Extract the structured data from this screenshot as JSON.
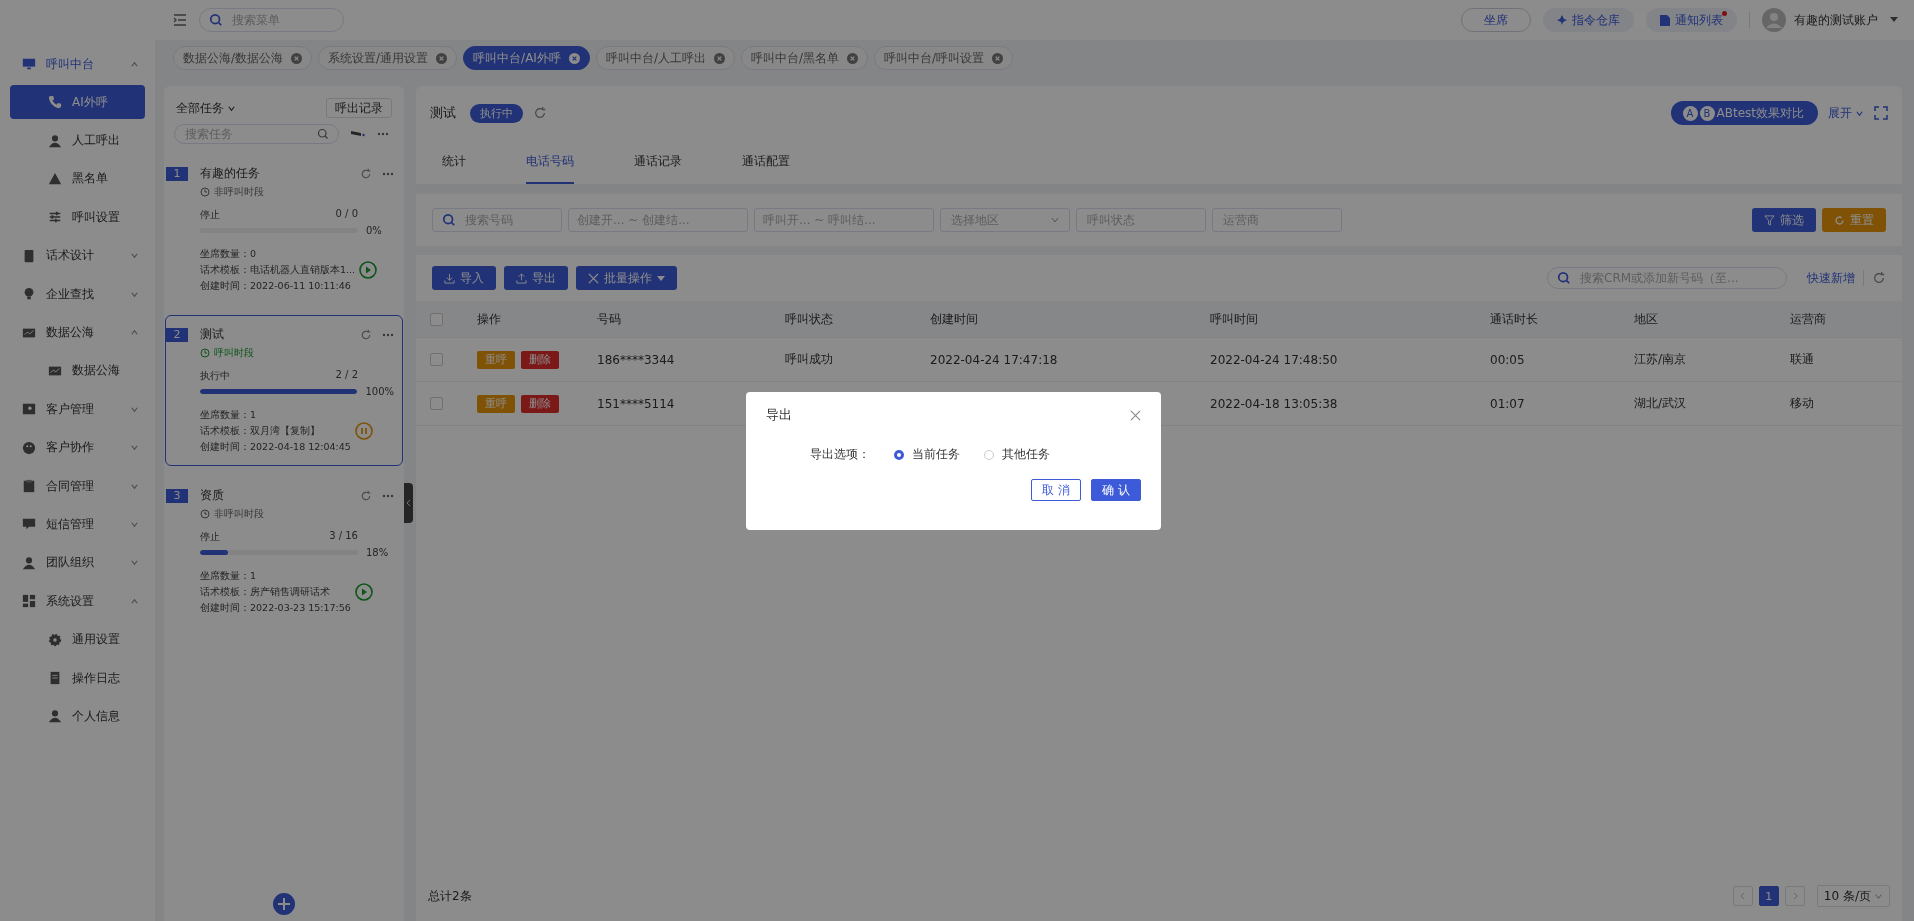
{
  "topbar": {
    "search_placeholder": "搜索菜单",
    "buttons": [
      {
        "label": "坐席",
        "unread": false
      },
      {
        "label": "指令仓库",
        "unread": false
      },
      {
        "label": "通知列表",
        "unread": true
      }
    ],
    "user": "有趣的测试账户"
  },
  "sidebar": {
    "items": [
      {
        "label": "呼叫中台",
        "expanded": true,
        "children": [
          {
            "label": "AI外呼",
            "selected": true
          },
          {
            "label": "人工呼出",
            "selected": false
          },
          {
            "label": "黑名单",
            "selected": false
          },
          {
            "label": "呼叫设置",
            "selected": false
          }
        ]
      },
      {
        "label": "话术设计",
        "expanded": false
      },
      {
        "label": "企业查找",
        "expanded": false
      },
      {
        "label": "数据公海",
        "expanded": true,
        "children": [
          {
            "label": "数据公海",
            "selected": false
          }
        ]
      },
      {
        "label": "客户管理",
        "expanded": false
      },
      {
        "label": "客户协作",
        "expanded": false
      },
      {
        "label": "合同管理",
        "expanded": false
      },
      {
        "label": "短信管理",
        "expanded": false
      },
      {
        "label": "团队组织",
        "expanded": false
      },
      {
        "label": "系统设置",
        "expanded": true,
        "children": [
          {
            "label": "通用设置",
            "selected": false
          },
          {
            "label": "操作日志",
            "selected": false
          },
          {
            "label": "个人信息",
            "selected": false
          }
        ]
      }
    ]
  },
  "tabs": [
    {
      "label": "数据公海/数据公海",
      "selected": false
    },
    {
      "label": "系统设置/通用设置",
      "selected": false
    },
    {
      "label": "呼叫中台/AI外呼",
      "selected": true
    },
    {
      "label": "呼叫中台/人工呼出",
      "selected": false
    },
    {
      "label": "呼叫中台/黑名单",
      "selected": false
    },
    {
      "label": "呼叫中台/呼叫设置",
      "selected": false
    }
  ],
  "task_panel": {
    "filter": "全部任务",
    "records_button": "呼出记录",
    "search_placeholder": "搜索任务",
    "tasks": [
      {
        "index": "1",
        "name": "有趣的任务",
        "period": "非呼叫时段",
        "in_call_period": false,
        "status": "停止",
        "count": "0 / 0",
        "percent": "0%",
        "level": 0,
        "seats": "坐席数量：0",
        "template": "话术模板：电话机器人直销版本1...",
        "created": "创建时间：2022-06-11 10:11:46",
        "kind": "start",
        "selected": false
      },
      {
        "index": "2",
        "name": "测试",
        "period": "呼叫时段",
        "in_call_period": true,
        "status": "执行中",
        "count": "2 / 2",
        "percent": "100%",
        "level": 1,
        "seats": "坐席数量：1",
        "template": "话术模板：双月湾【复制】",
        "created": "创建时间：2022-04-18 12:04:45",
        "kind": "pause",
        "selected": true
      },
      {
        "index": "3",
        "name": "资质",
        "period": "非呼叫时段",
        "in_call_period": false,
        "status": "停止",
        "count": "3 / 16",
        "percent": "18%",
        "level": 0.18,
        "seats": "坐席数量：1",
        "template": "话术模板：房产销售调研话术",
        "created": "创建时间：2022-03-23 15:17:56",
        "kind": "start",
        "selected": false
      }
    ]
  },
  "main": {
    "title": "测试",
    "status": "执行中",
    "ab_letters": [
      "A",
      "B"
    ],
    "ab_button": "ABtest效果对比",
    "expand": "展开",
    "tabs": [
      {
        "label": "统计",
        "selected": false
      },
      {
        "label": "电话号码",
        "selected": true
      },
      {
        "label": "通话记录",
        "selected": false
      },
      {
        "label": "通话配置",
        "selected": false
      }
    ],
    "filters": [
      {
        "kind": "search",
        "placeholder": "搜索号码"
      },
      {
        "kind": "range",
        "placeholder": "创建开... ~ 创建结..."
      },
      {
        "kind": "range",
        "placeholder": "呼叫开... ~ 呼叫结..."
      },
      {
        "kind": "select",
        "placeholder": "选择地区"
      },
      {
        "kind": "input",
        "placeholder": "呼叫状态"
      },
      {
        "kind": "input",
        "placeholder": "运营商"
      }
    ],
    "filter_button": "筛选",
    "reset_button": "重置",
    "toolbar": [
      {
        "label": "导入",
        "kind": "import"
      },
      {
        "label": "导出",
        "kind": "export"
      },
      {
        "label": "批量操作",
        "kind": "menu"
      }
    ],
    "crm_search_placeholder": "搜索CRM或添加新号码（至...",
    "quick_add": "快速新增",
    "table": {
      "all_checked": false,
      "columns": [
        "操作",
        "号码",
        "呼叫状态",
        "创建时间",
        "呼叫时间",
        "通话时长",
        "地区",
        "运营商"
      ],
      "rows": [
        {
          "checked": false,
          "actions": [
            "重呼",
            "删除"
          ],
          "cells": [
            "",
            "186****3344",
            "呼叫成功",
            "2022-04-24 17:47:18",
            "2022-04-24 17:48:50",
            "00:05",
            "江苏/南京",
            "联通"
          ]
        },
        {
          "checked": false,
          "actions": [
            "重呼",
            "删除"
          ],
          "cells": [
            "",
            "151****5114",
            "",
            "",
            "2022-04-18 13:05:38",
            "01:07",
            "湖北/武汉",
            "移动"
          ]
        }
      ]
    },
    "total": "总计2条",
    "pages": [
      {
        "label": "1",
        "selected": true
      }
    ],
    "page_size": "10 条/页"
  },
  "dialog": {
    "title": "导出",
    "option_label": "导出选项：",
    "options": [
      {
        "label": "当前任务",
        "selected": true
      },
      {
        "label": "其他任务",
        "selected": false
      }
    ],
    "cancel": "取 消",
    "confirm": "确 认"
  }
}
